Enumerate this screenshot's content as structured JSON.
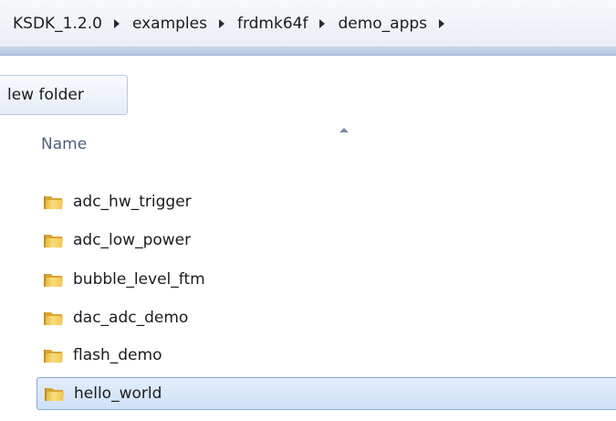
{
  "breadcrumb": [
    "KSDK_1.2.0",
    "examples",
    "frdmk64f",
    "demo_apps"
  ],
  "toolbar": {
    "new_folder_label": "lew folder"
  },
  "columns": {
    "name_label": "Name"
  },
  "folders": [
    {
      "name": "adc_hw_trigger",
      "selected": false
    },
    {
      "name": "adc_low_power",
      "selected": false
    },
    {
      "name": "bubble_level_ftm",
      "selected": false
    },
    {
      "name": "dac_adc_demo",
      "selected": false
    },
    {
      "name": "flash_demo",
      "selected": false
    },
    {
      "name": "hello_world",
      "selected": true
    }
  ],
  "colors": {
    "selection": "#cfe1f7",
    "selection_border": "#84acdd",
    "folder_yellow": "#f1c64b"
  }
}
